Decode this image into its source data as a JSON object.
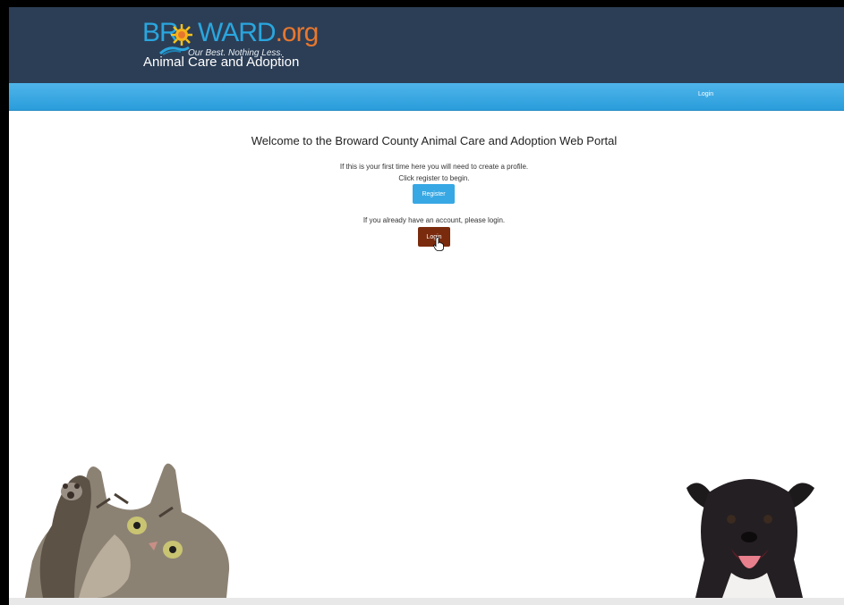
{
  "header": {
    "logo": {
      "wordmark_left": "BR",
      "wordmark_right": "WARD",
      "wordmark_suffix": ".org",
      "tagline": "Our Best. Nothing Less."
    },
    "title": "Animal Care and Adoption"
  },
  "navbar": {
    "login_label": "Login"
  },
  "main": {
    "welcome": "Welcome to the Broward County Animal Care and Adoption Web Portal",
    "first_time_text": "If this is your first time here you will need to create a profile.",
    "register_prompt": "Click register to begin.",
    "register_label": "Register",
    "login_prompt": "If you already have an account, please login.",
    "login_label": "Login"
  },
  "icons": {
    "logo_sun": "sun-icon",
    "cursor": "hand-pointer-icon"
  },
  "colors": {
    "header_bg": "#2c3e56",
    "navbar_bg": "#2a9ddb",
    "register_btn": "#37a8e4",
    "login_btn": "#7a2b0e",
    "logo_blue": "#2aa6de",
    "logo_orange": "#e8772e"
  }
}
